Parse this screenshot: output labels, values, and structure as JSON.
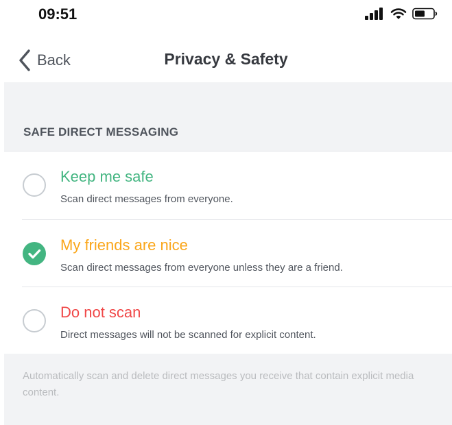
{
  "status_bar": {
    "time": "09:51"
  },
  "nav": {
    "back_label": "Back",
    "title": "Privacy & Safety"
  },
  "section": {
    "header": "SAFE DIRECT MESSAGING"
  },
  "options": [
    {
      "title": "Keep me safe",
      "description": "Scan direct messages from everyone.",
      "color": "#43b581",
      "selected": false
    },
    {
      "title": "My friends are nice",
      "description": "Scan direct messages from everyone unless they are a friend.",
      "color": "#faa61a",
      "selected": true
    },
    {
      "title": "Do not scan",
      "description": "Direct messages will not be scanned for explicit content.",
      "color": "#f04747",
      "selected": false
    }
  ],
  "footer": {
    "text": "Automatically scan and delete direct messages you receive that contain explicit media content."
  },
  "colors": {
    "accent_green": "#43b581",
    "background_gray": "#f2f3f5"
  },
  "icons": {
    "back": "chevron-left-icon",
    "signal": "cellular-signal-icon",
    "wifi": "wifi-icon",
    "battery": "battery-icon",
    "check": "checkmark-icon"
  }
}
